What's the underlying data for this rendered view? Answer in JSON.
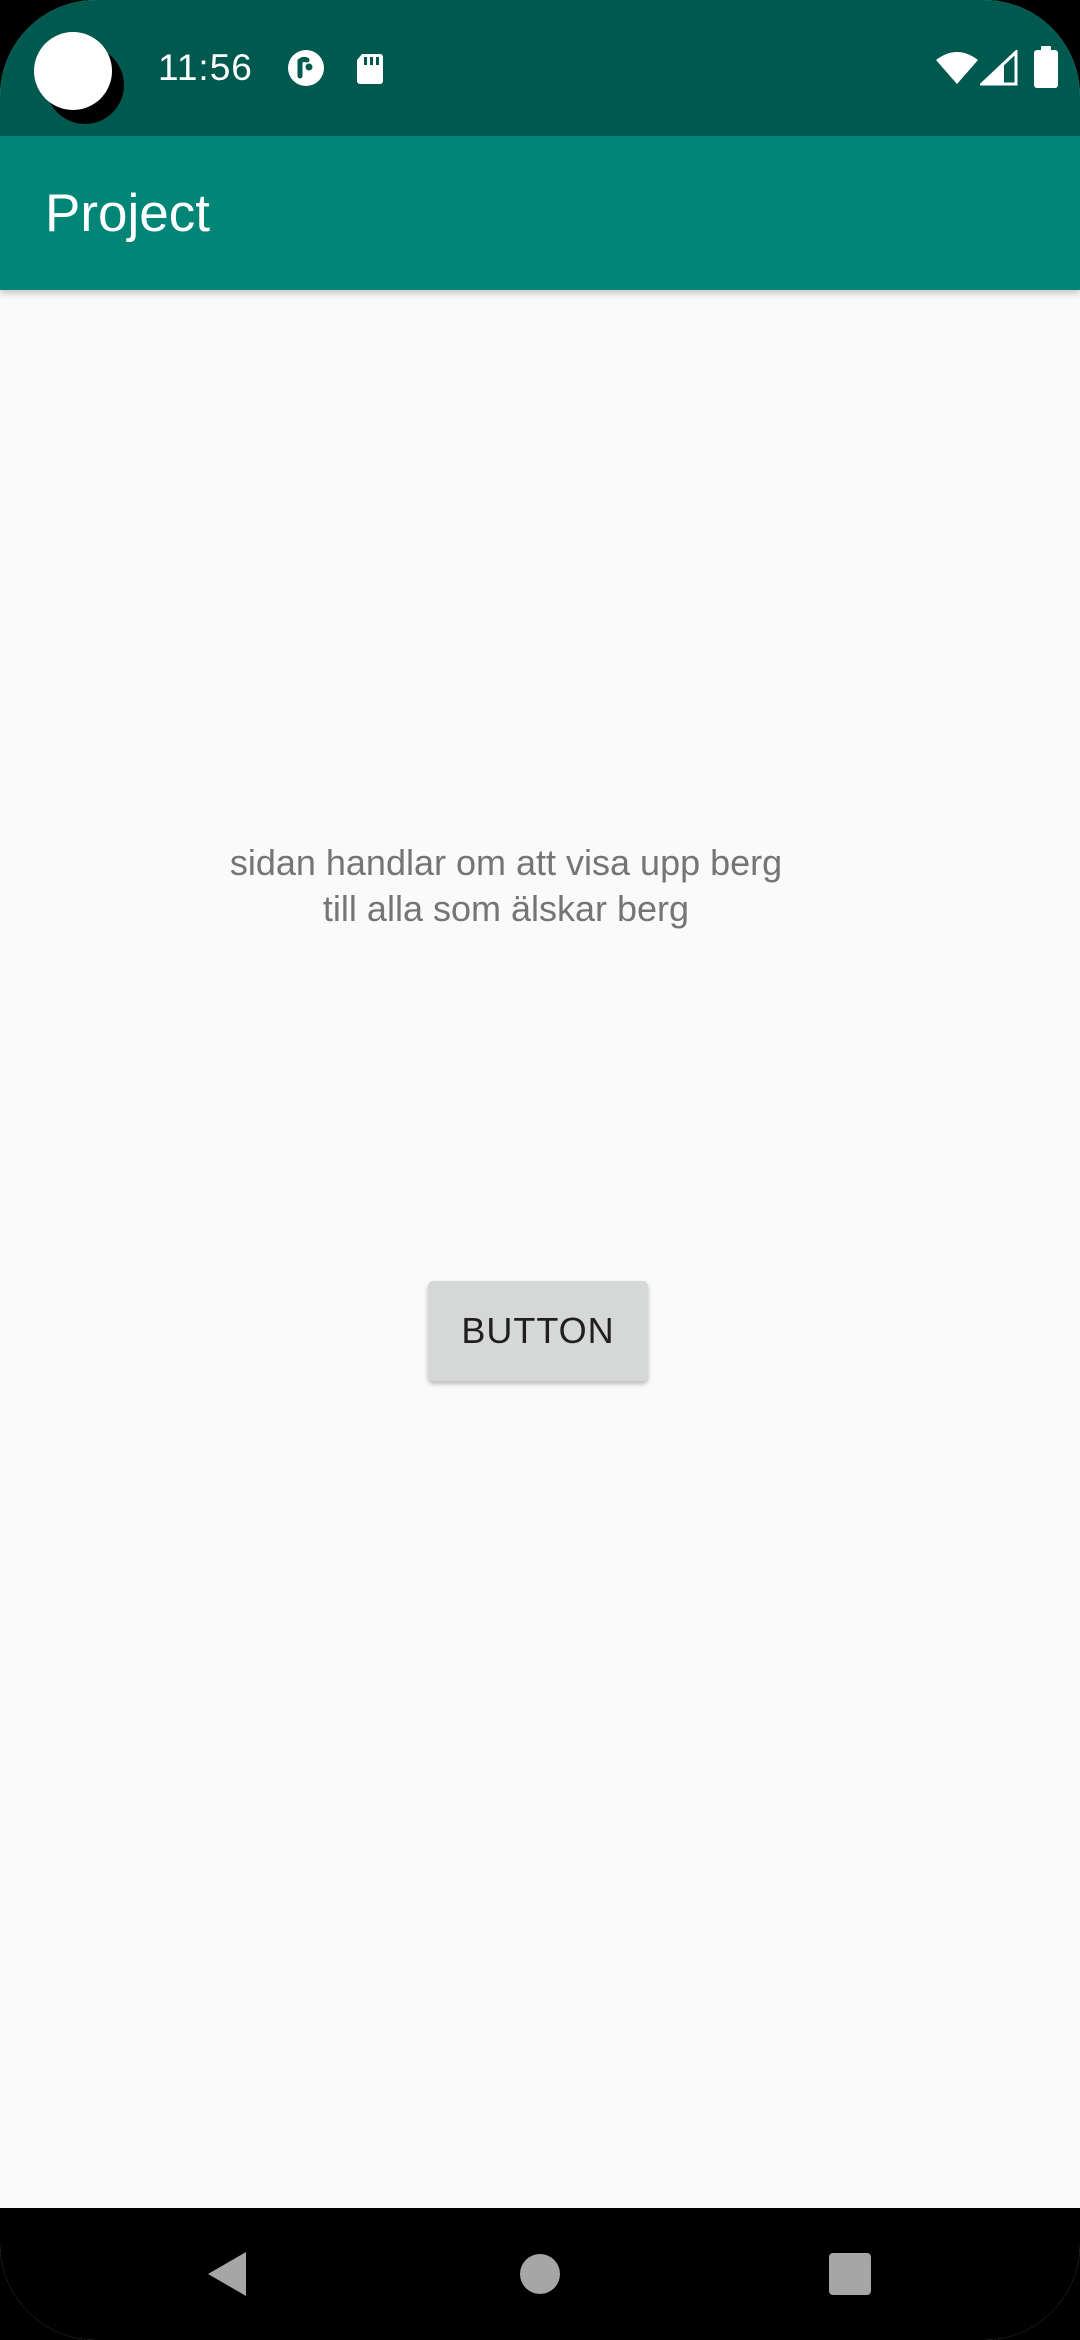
{
  "status_bar": {
    "time": "11:56",
    "icons": [
      "pocket-casts-icon",
      "sd-card-icon",
      "wifi-icon",
      "cell-signal-icon",
      "battery-icon"
    ]
  },
  "app_bar": {
    "title": "Project",
    "color": "#008577",
    "status_color": "#00594f"
  },
  "content": {
    "description_lines": [
      "sidan handlar om att visa upp berg",
      "till alla som älskar berg"
    ],
    "button_label": "BUTTON"
  },
  "nav_bar": {
    "icons": [
      "back-icon",
      "home-icon",
      "recents-icon"
    ]
  }
}
